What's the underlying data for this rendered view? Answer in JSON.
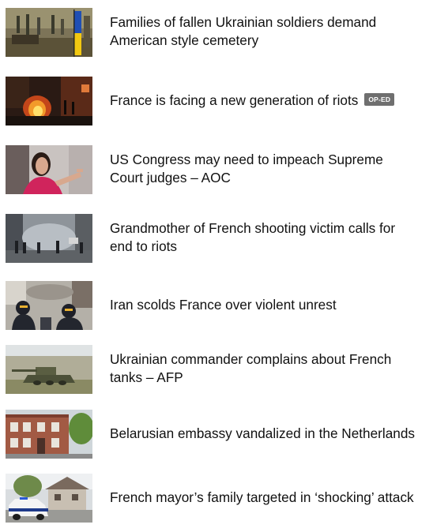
{
  "articles": [
    {
      "lines": [
        "Families of fallen Ukrainian soldiers demand",
        "American style cemetery"
      ],
      "thumbnail": "soldiers-flag-image"
    },
    {
      "lines": [
        "France is facing a new generation of riots"
      ],
      "badge": "OP-ED",
      "thumbnail": "riot-fire-image"
    },
    {
      "lines": [
        "US Congress may need to impeach Supreme",
        "Court judges – AOC"
      ],
      "thumbnail": "speaker-pointing-image"
    },
    {
      "lines": [
        "Grandmother of French shooting victim calls for",
        "end to riots"
      ],
      "thumbnail": "street-smoke-image"
    },
    {
      "lines": [
        "Iran scolds France over violent unrest"
      ],
      "thumbnail": "riot-police-image"
    },
    {
      "lines": [
        "Ukrainian commander complains about French",
        "tanks – AFP"
      ],
      "thumbnail": "tank-field-image"
    },
    {
      "lines": [
        "Belarusian embassy vandalized in the Netherlands"
      ],
      "thumbnail": "embassy-building-image"
    },
    {
      "lines": [
        "French mayor’s family targeted in ‘shocking’ attack"
      ],
      "thumbnail": "police-car-house-image"
    }
  ]
}
